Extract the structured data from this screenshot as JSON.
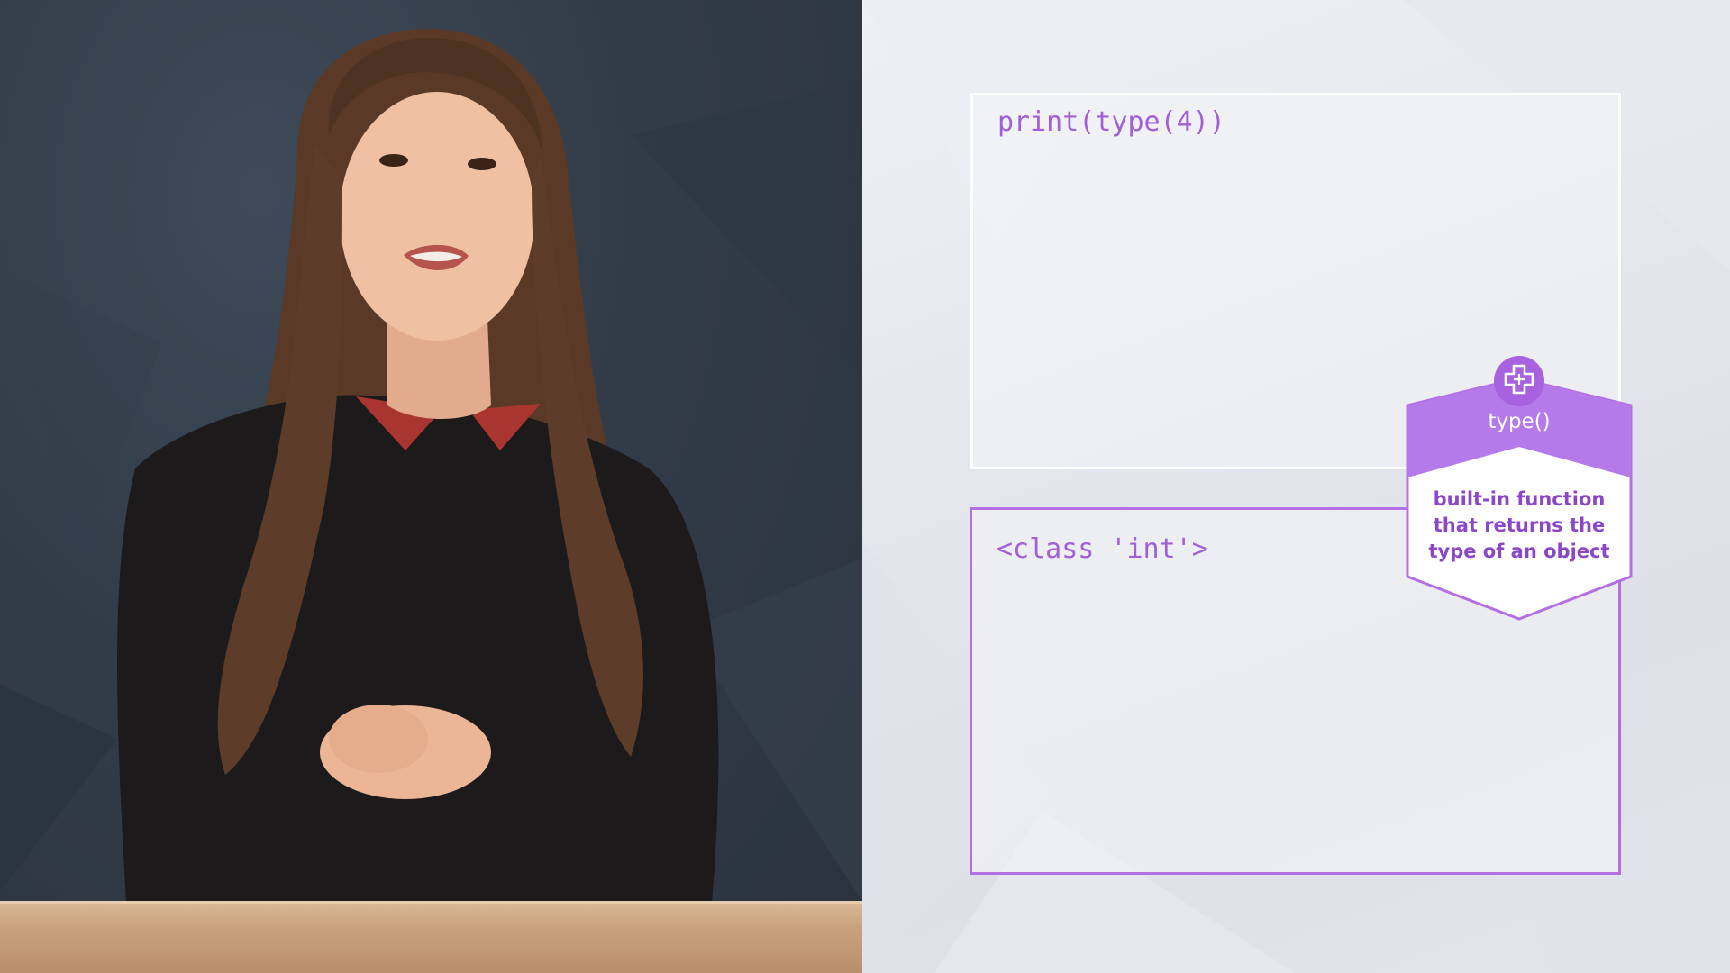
{
  "presenter": {
    "icon": "presenter-video-frame"
  },
  "slide": {
    "code": "print(type(4))",
    "output": "<class 'int'>",
    "callout": {
      "icon": "puzzle-piece-icon",
      "title": "type()",
      "description_lines": [
        "built-in function",
        "that returns the",
        "type of an object"
      ]
    }
  },
  "colors": {
    "accent": "#b46fe3",
    "code_text": "#a160d6",
    "callout_header": "#b57ae9",
    "callout_text": "#8a47c9",
    "presenter_bg": "#323c48"
  }
}
